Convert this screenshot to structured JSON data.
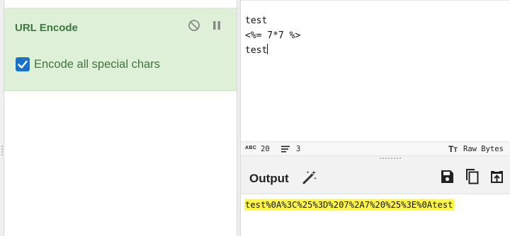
{
  "recipe": {
    "operation": {
      "title": "URL Encode",
      "disable_icon": "disable-icon",
      "pause_icon": "pause-icon",
      "option": {
        "label": "Encode all special chars",
        "checked": true
      }
    }
  },
  "input": {
    "lines": [
      "test",
      "<%= 7*7 %>",
      "test"
    ]
  },
  "status_bar": {
    "abc_icon": "ABC",
    "length": "20",
    "lines": "3",
    "tt_icon": "T",
    "tt_icon_small": "T",
    "raw_bytes": "Raw Bytes"
  },
  "output": {
    "title": "Output",
    "magic_icon": "magic-wand-icon",
    "save_icon": "save-icon",
    "copy_icon": "copy-icon",
    "replace_icon": "replace-input-icon",
    "value": "test%0A%3C%25%3D%207%2A7%20%25%3E%0Atest",
    "highlight_color": "#fff64d"
  },
  "colors": {
    "op_bg": "#dff0d8",
    "op_text": "#3c763d",
    "checkbox": "#1a73c9"
  }
}
